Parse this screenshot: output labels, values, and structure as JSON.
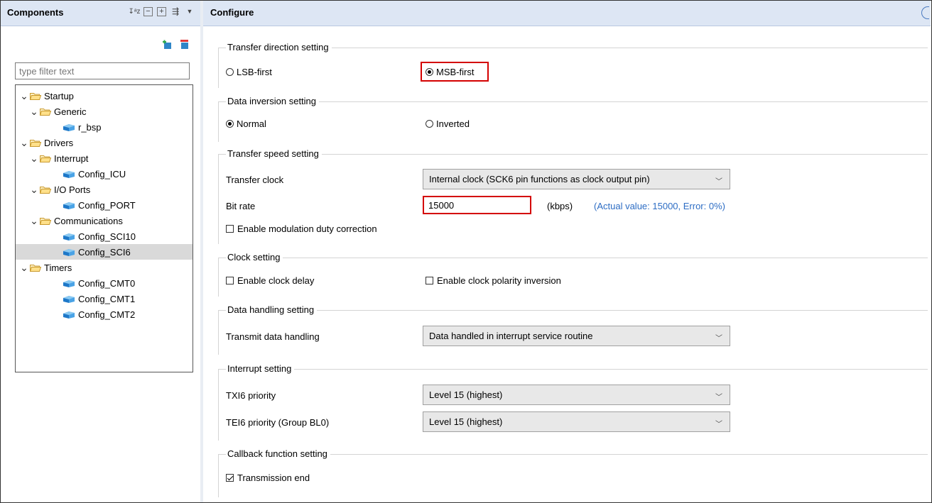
{
  "components_panel": {
    "title": "Components",
    "filter_placeholder": "type filter text",
    "tree": [
      {
        "label": "Startup",
        "type": "folder",
        "level": 0
      },
      {
        "label": "Generic",
        "type": "folder",
        "level": 1
      },
      {
        "label": "r_bsp",
        "type": "leaf",
        "level": 2
      },
      {
        "label": "Drivers",
        "type": "folder",
        "level": 0
      },
      {
        "label": "Interrupt",
        "type": "folder",
        "level": 1
      },
      {
        "label": "Config_ICU",
        "type": "leaf",
        "level": 2
      },
      {
        "label": "I/O Ports",
        "type": "folder",
        "level": 1
      },
      {
        "label": "Config_PORT",
        "type": "leaf",
        "level": 2
      },
      {
        "label": "Communications",
        "type": "folder",
        "level": 1
      },
      {
        "label": "Config_SCI10",
        "type": "leaf",
        "level": 2
      },
      {
        "label": "Config_SCI6",
        "type": "leaf",
        "level": 2,
        "selected": true
      },
      {
        "label": "Timers",
        "type": "folder",
        "level": 0
      },
      {
        "label": "Config_CMT0",
        "type": "leaf",
        "level": 2
      },
      {
        "label": "Config_CMT1",
        "type": "leaf",
        "level": 2
      },
      {
        "label": "Config_CMT2",
        "type": "leaf",
        "level": 2
      }
    ]
  },
  "configure_panel": {
    "title": "Configure",
    "transfer_direction": {
      "title": "Transfer direction setting",
      "option1": "LSB-first",
      "option2": "MSB-first",
      "selected": "MSB-first"
    },
    "data_inversion": {
      "title": "Data inversion setting",
      "option1": "Normal",
      "option2": "Inverted",
      "selected": "Normal"
    },
    "transfer_speed": {
      "title": "Transfer speed setting",
      "clock_label": "Transfer clock",
      "clock_value": "Internal clock (SCK6 pin functions as clock output pin)",
      "bitrate_label": "Bit rate",
      "bitrate_value": "15000",
      "bitrate_unit": "(kbps)",
      "bitrate_note": "(Actual value: 15000, Error: 0%)",
      "modulation_label": "Enable modulation duty correction"
    },
    "clock_setting": {
      "title": "Clock setting",
      "delay_label": "Enable clock delay",
      "polarity_label": "Enable clock polarity inversion"
    },
    "data_handling": {
      "title": "Data handling setting",
      "label": "Transmit data handling",
      "value": "Data handled in interrupt service routine"
    },
    "interrupt": {
      "title": "Interrupt setting",
      "txi_label": "TXI6 priority",
      "txi_value": "Level 15 (highest)",
      "tei_label": "TEI6 priority (Group BL0)",
      "tei_value": "Level 15 (highest)"
    },
    "callback": {
      "title": "Callback function setting",
      "label": "Transmission end",
      "checked": true
    }
  },
  "colors": {
    "header_bg": "#dde6f4",
    "highlight": "#d40000",
    "note": "#2d6dc4",
    "selection": "#d9d9d9"
  }
}
